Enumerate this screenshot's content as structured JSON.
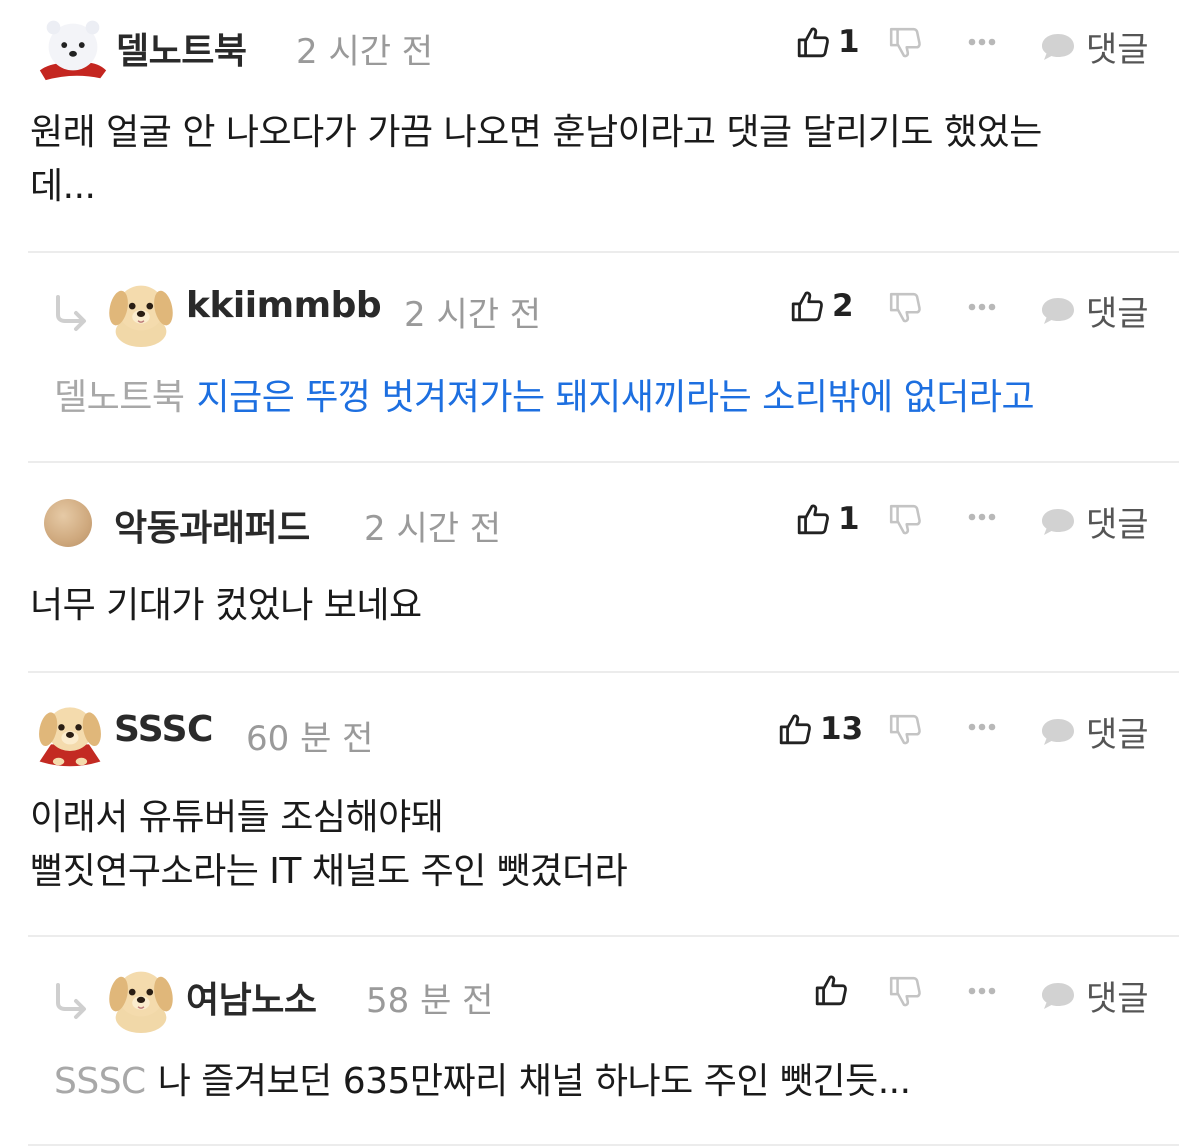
{
  "colors": {
    "link": "#1d6fe0",
    "mention": "#a8a8a8",
    "time": "#9a9a9a",
    "divider": "#ececec"
  },
  "comments": [
    {
      "nick": "델노트북",
      "time": "2 시간 전",
      "likes": "1",
      "avatar": "polar-bear-avatar",
      "body": "원래 얼굴 안 나오다가 가끔 나오면 훈남이라고 댓글 달리기도 했었는\n데..."
    },
    {
      "nick": "kkiimmbb",
      "time": "2 시간 전",
      "likes": "2",
      "avatar": "puppy-avatar",
      "is_reply": true,
      "mention": "델노트북",
      "body": "지금은 뚜껑 벗겨져가는 돼지새끼라는 소리밖에 없더라고"
    },
    {
      "nick": "악동과래퍼드",
      "time": "2 시간 전",
      "likes": "1",
      "avatar": "beige-circle-avatar",
      "body": "너무 기대가 컸었나 보네요"
    },
    {
      "nick": "SSSC",
      "time": "60 분 전",
      "likes": "13",
      "avatar": "puppy-scarf-avatar",
      "body": "이래서 유튜버들 조심해야돼\n뻘짓연구소라는 IT 채널도 주인 뺏겼더라"
    },
    {
      "nick": "여남노소",
      "time": "58 분 전",
      "likes": "",
      "avatar": "puppy-avatar",
      "is_reply": true,
      "mention": "SSSC",
      "body": "나 즐겨보던 635만짜리 채널 하나도 주인 뺏긴듯..."
    }
  ],
  "labels": {
    "reply": "댓글"
  }
}
